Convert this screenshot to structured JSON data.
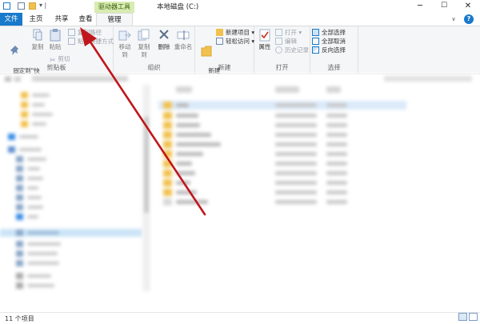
{
  "titlebar": {
    "context_tab": "驱动器工具",
    "window_title": "本地磁盘 (C:)",
    "minimize": "─",
    "maximize": "☐",
    "close": "✕",
    "qa_label": "▾ |"
  },
  "tabs": [
    {
      "label": "文件"
    },
    {
      "label": "主页"
    },
    {
      "label": "共享"
    },
    {
      "label": "查看"
    },
    {
      "label": "管理"
    }
  ],
  "ribbon": {
    "clipboard": {
      "group_label": "剪贴板",
      "pin_label": "固定到\"快\n速访问\"",
      "copy_label": "复制",
      "paste_label": "粘贴",
      "copy_path": "复制路径",
      "paste_shortcut": "粘贴快捷方式",
      "cut": "剪切"
    },
    "organize": {
      "group_label": "组织",
      "move_to": "移动到",
      "copy_to": "复制到",
      "delete": "删除",
      "rename": "重命名"
    },
    "new": {
      "group_label": "新建",
      "new_folder": "新建\n文件夹",
      "new_item": "新建项目 ▾",
      "easy_access": "轻松访问 ▾"
    },
    "open": {
      "group_label": "打开",
      "properties": "属性",
      "open": "打开 ▾",
      "edit": "编辑",
      "history": "历史记录"
    },
    "select": {
      "group_label": "选择",
      "select_all": "全部选择",
      "select_none": "全部取消",
      "invert": "反向选择"
    }
  },
  "status": {
    "item_count": "11 个项目"
  },
  "colors": {
    "accent": "#1979ca",
    "context_tab_bg": "#d8ecb2",
    "arrow": "#c0161c",
    "folder": "#f1c14e"
  }
}
